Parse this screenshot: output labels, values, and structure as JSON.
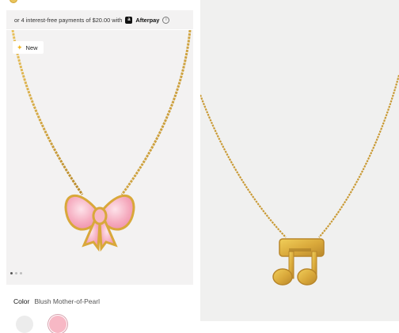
{
  "afterpay": {
    "text": "or 4 interest-free payments of $20.00 with",
    "brand": "Afterpay",
    "info": "i"
  },
  "product": {
    "badge": "New",
    "carousel": {
      "total": 3,
      "active": 1
    }
  },
  "color": {
    "label": "Color",
    "value": "Blush Mother-of-Pearl",
    "swatches": [
      "#ececec",
      "#f7b8c5"
    ]
  },
  "colors": {
    "gold": "#d9a83a",
    "blush": "#f7b8c5",
    "image_bg": "#f3f2f2",
    "right_bg": "#f0f0ef"
  },
  "icons": [
    "sparkle-icon",
    "afterpay-logo-icon",
    "info-icon"
  ]
}
